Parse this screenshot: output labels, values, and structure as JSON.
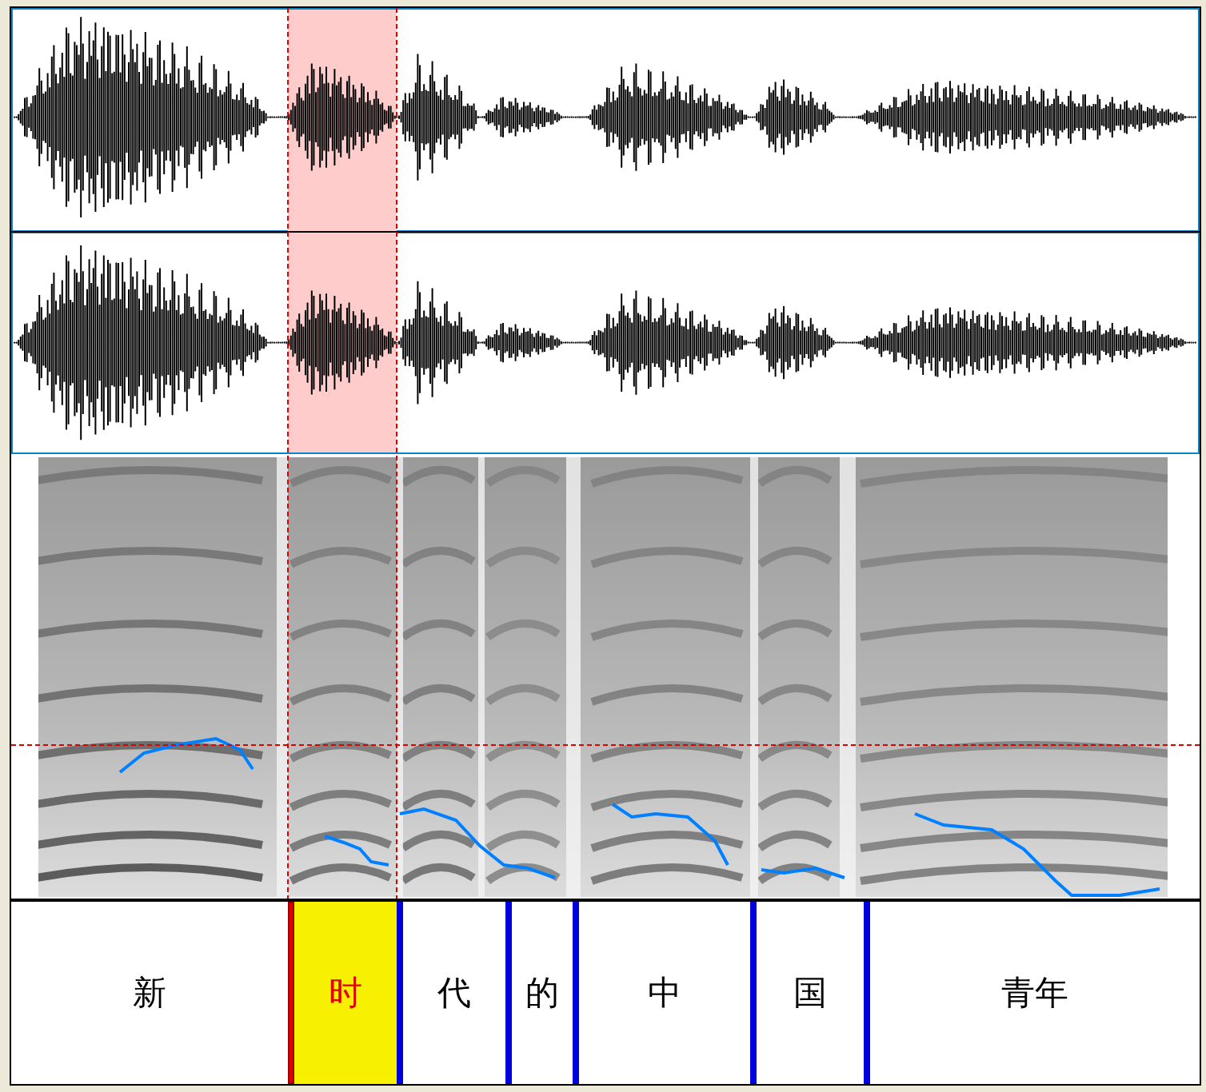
{
  "tier": {
    "intervals": [
      {
        "text": "新",
        "selected": false
      },
      {
        "text": "时",
        "selected": true
      },
      {
        "text": "代",
        "selected": false
      },
      {
        "text": "的",
        "selected": false
      },
      {
        "text": "中",
        "selected": false
      },
      {
        "text": "国",
        "selected": false
      },
      {
        "text": "青年",
        "selected": false
      }
    ]
  }
}
